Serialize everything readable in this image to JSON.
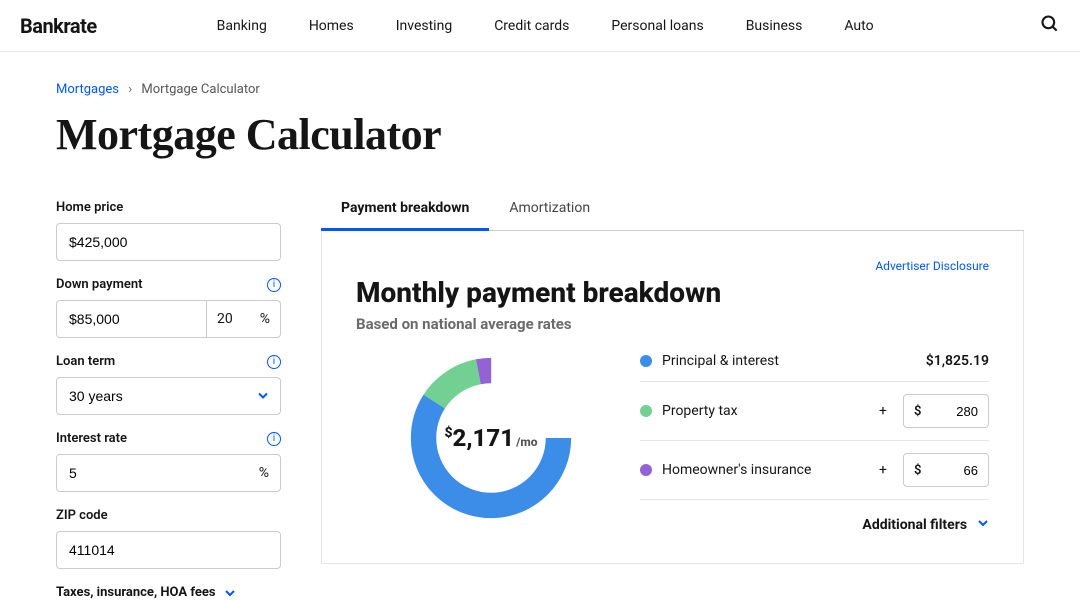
{
  "brand": "Bankrate",
  "nav": [
    "Banking",
    "Homes",
    "Investing",
    "Credit cards",
    "Personal loans",
    "Business",
    "Auto"
  ],
  "breadcrumb": {
    "root": "Mortgages",
    "current": "Mortgage Calculator"
  },
  "page_title": "Mortgage Calculator",
  "form": {
    "home_price_label": "Home price",
    "home_price_value": "$425,000",
    "down_payment_label": "Down payment",
    "down_payment_value": "$85,000",
    "down_payment_pct": "20",
    "pct_symbol": "%",
    "loan_term_label": "Loan term",
    "loan_term_value": "30 years",
    "interest_rate_label": "Interest rate",
    "interest_rate_value": "5",
    "zip_label": "ZIP code",
    "zip_value": "411014",
    "taxes_toggle": "Taxes, insurance, HOA fees"
  },
  "tabs": {
    "payment": "Payment breakdown",
    "amortization": "Amortization"
  },
  "disclosure": "Advertiser Disclosure",
  "breakdown": {
    "title": "Monthly payment breakdown",
    "subtitle": "Based on national average rates",
    "total": "2,171",
    "permo": "/mo",
    "legend": {
      "principal": "Principal & interest",
      "principal_value": "$1,825.19",
      "tax": "Property tax",
      "tax_value": "280",
      "insurance": "Homeowner's insurance",
      "insurance_value": "66",
      "additional": "Additional filters"
    },
    "colors": {
      "principal": "#3b8de8",
      "tax": "#72d092",
      "insurance": "#9363d6"
    }
  },
  "chart_data": {
    "type": "pie",
    "title": "Monthly payment breakdown",
    "series": [
      {
        "name": "Principal & interest",
        "value": 1825.19,
        "color": "#3b8de8"
      },
      {
        "name": "Property tax",
        "value": 280,
        "color": "#72d092"
      },
      {
        "name": "Homeowner's insurance",
        "value": 66,
        "color": "#9363d6"
      }
    ],
    "total": 2171,
    "unit": "$ / mo"
  }
}
